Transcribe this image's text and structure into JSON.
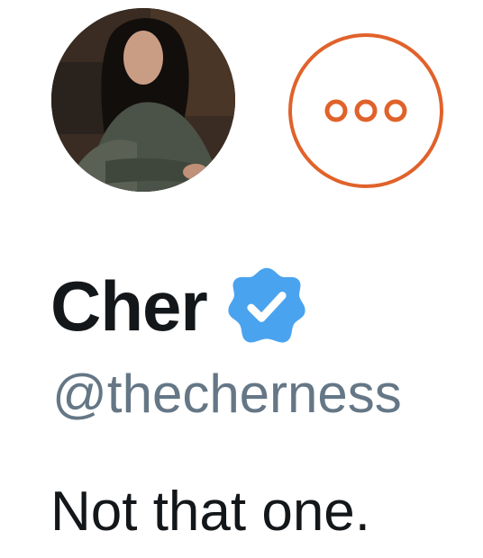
{
  "profile": {
    "display_name": "Cher",
    "handle": "@thecherness",
    "bio": "Not that one.",
    "verified": true,
    "avatar_icon": "avatar-photo"
  },
  "actions": {
    "more_icon": "more-options-icon"
  },
  "colors": {
    "accent": "#e0622b",
    "verified_blue": "#4aa3ee",
    "name_text": "#14171a",
    "handle_text": "#657786"
  }
}
